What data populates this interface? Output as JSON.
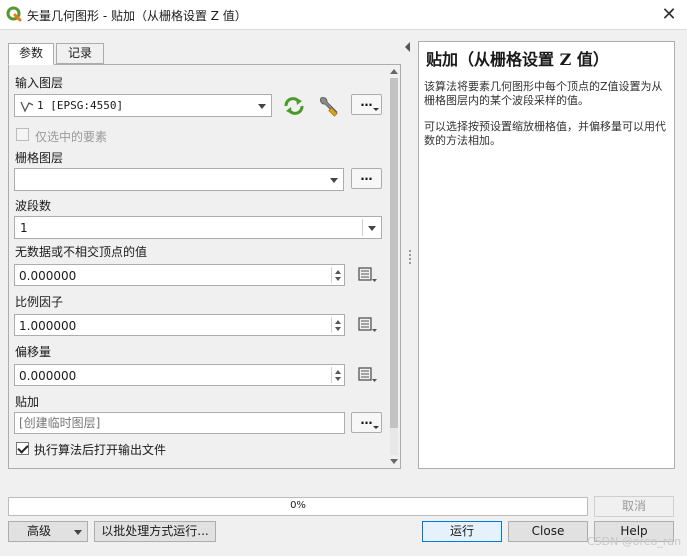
{
  "window": {
    "title": "矢量几何图形 - 贴加（从栅格设置 Z 值）",
    "close_glyph": "✕"
  },
  "tabs": [
    {
      "label": "参数",
      "active": true
    },
    {
      "label": "记录",
      "active": false
    }
  ],
  "params": {
    "input_layer": {
      "label": "输入图层",
      "value": "1 [EPSG:4550]",
      "icon": "line-layer-icon",
      "dots": "…"
    },
    "selected_only": {
      "label": "仅选中的要素",
      "checked": false,
      "enabled": false
    },
    "raster_layer": {
      "label": "栅格图层",
      "value": "",
      "dots": "…"
    },
    "band": {
      "label": "波段数",
      "value": "1"
    },
    "nodata": {
      "label": "无数据或不相交顶点的值",
      "value": "0.000000"
    },
    "scale": {
      "label": "比例因子",
      "value": "1.000000"
    },
    "offset": {
      "label": "偏移量",
      "value": "0.000000"
    },
    "output": {
      "label": "贴加",
      "placeholder": "[创建临时图层]",
      "dots": "…"
    },
    "open_after": {
      "label": "执行算法后打开输出文件",
      "checked": true
    }
  },
  "help": {
    "title": "贴加（从栅格设置 Z 值）",
    "paragraphs": [
      "该算法将要素几何图形中每个顶点的Z值设置为从栅格图层内的某个波段采样的值。",
      "可以选择按预设置缩放栅格值，并偏移量可以用代数的方法相加。"
    ]
  },
  "progress": {
    "value": 0,
    "label": "0%"
  },
  "buttons": {
    "cancel": "取消",
    "advanced": "高级",
    "batch": "以批处理方式运行...",
    "run": "运行",
    "close": "Close",
    "help": "Help"
  },
  "watermark": "CSDN @oreo_ran",
  "colors": {
    "accent": "#0078d7",
    "qgis_green": "#589632",
    "progress_fill": "#06b025"
  }
}
